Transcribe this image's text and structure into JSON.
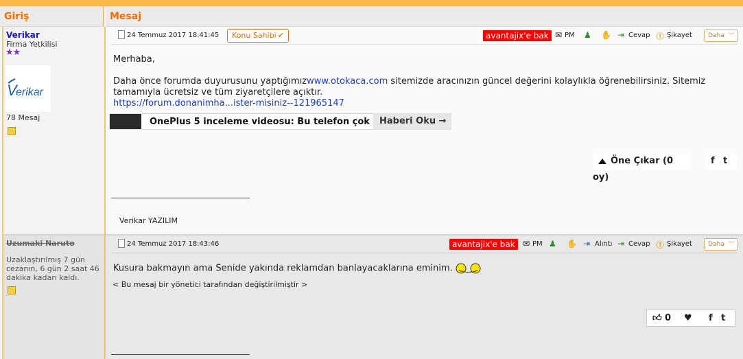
{
  "header": {
    "col_left": "Giriş",
    "col_right": "Mesaj"
  },
  "post1": {
    "author": {
      "name": "Verikar",
      "role": "Firma Yetkilisi",
      "stars": "★★",
      "avatar_text": "Verikar",
      "messages": "78 Mesaj"
    },
    "date": "24 Temmuz 2017 18:41:45",
    "owner_badge": "Konu Sahibi",
    "actions": {
      "bak": "avantajix'e bak",
      "pm": "PM",
      "cevap": "Cevap",
      "sikayet": "Şikayet",
      "daha": "Daha"
    },
    "body": {
      "greeting": "Merhaba,",
      "text_before_link": "Daha önce forumda duyurusunu yaptığımız",
      "link": "www.otokaca.com",
      "text_after_link": " sitemizde aracınızın güncel değerini kolaylıkla öğrenebilirsiniz. Sitemiz",
      "line2": "tamamıyla ücretsiz ve tüm ziyaretçilere açıktır.",
      "url": "https://forum.donanimha...ister-misiniz--121965147"
    },
    "news": {
      "title": "OnePlus 5 inceleme videosu: Bu telefon çok ...",
      "button": "Haberi Oku →"
    },
    "one_cikar": "Öne Çıkar (0 oy)",
    "share": {
      "facebook": "f",
      "twitter": "t"
    },
    "signature": "Verikar YAZILIM"
  },
  "post2": {
    "author": {
      "name": "Uzumaki Naruto",
      "ban_text": "Uzaklaştırılmış 7 gün cezanın, 6 gün 2 saat 46 dakika kadarı kaldı."
    },
    "date": "24 Temmuz 2017 18:43:46",
    "actions": {
      "bak": "avantajix'e bak",
      "pm": "PM",
      "alinti": "Alıntı",
      "cevap": "Cevap",
      "sikayet": "Şikayet",
      "daha": "Daha"
    },
    "body": "Kusura bakmayın ama Senide yakında reklamdan banlayacaklarına eminim.",
    "note": "< Bu mesaj bir yönetici tarafından değiştirilmiştir >",
    "likes": "0"
  }
}
